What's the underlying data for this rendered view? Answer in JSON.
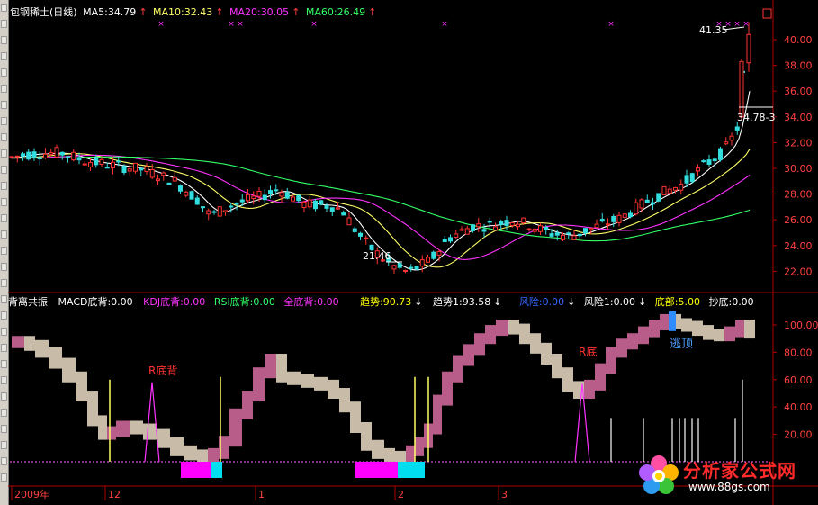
{
  "price_panel": {
    "stock": "包钢稀土(日线)",
    "ma": [
      {
        "label": "MA5:34.79",
        "color": "#ffffff"
      },
      {
        "label": "MA10:32.43",
        "color": "#ffff66"
      },
      {
        "label": "MA20:30.05",
        "color": "#ff33ff"
      },
      {
        "label": "MA60:26.49",
        "color": "#33ff66"
      }
    ],
    "y_ticks": [
      "40.00",
      "38.00",
      "36.00",
      "34.00",
      "32.00",
      "30.00",
      "28.00",
      "26.00",
      "24.00",
      "22.00"
    ],
    "annot_low": "21.46",
    "annot_high": "41.35",
    "annot_current": "34.78-3"
  },
  "indicator_panel": {
    "title": "背离共振",
    "legend": [
      {
        "label": "MACD底背:0.00",
        "color": "#ffffff"
      },
      {
        "label": "KDJ底背:0.00",
        "color": "#ff33ff"
      },
      {
        "label": "RSI底背:0.00",
        "color": "#33ff66"
      },
      {
        "label": "全底背:0.00",
        "color": "#ff33ff"
      },
      {
        "label": "趋势:90.73",
        "color": "#ffff00"
      },
      {
        "label": "趋势1:93.58",
        "color": "#ffffff"
      },
      {
        "label": "风险:0.00",
        "color": "#3366ff"
      },
      {
        "label": "风险1:0.00",
        "color": "#ffffff"
      },
      {
        "label": "底部:5.00",
        "color": "#ffff00"
      },
      {
        "label": "抄底:0.00",
        "color": "#ffffff"
      }
    ],
    "y_ticks": [
      "100.00",
      "80.00",
      "60.00",
      "40.00",
      "20.00"
    ],
    "label_r1": "R底背",
    "label_r2": "R底",
    "label_escape": "逃顶"
  },
  "date_axis": {
    "labels": [
      "2009年",
      "12",
      "1",
      "2",
      "3"
    ]
  },
  "watermark": {
    "name": "分析家公式网",
    "url": "www.88gs.com"
  }
}
